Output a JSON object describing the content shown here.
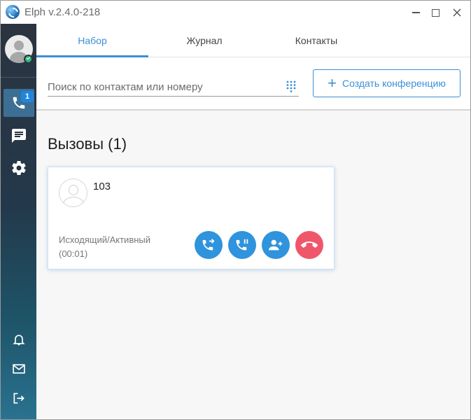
{
  "app": {
    "title": "Elph v.2.4.0-218"
  },
  "sidebar": {
    "calls_badge": "1",
    "items": [
      {
        "name": "calls",
        "icon": "phone-icon"
      },
      {
        "name": "chat",
        "icon": "chat-icon"
      },
      {
        "name": "settings",
        "icon": "gear-icon"
      },
      {
        "name": "notifications",
        "icon": "bell-icon"
      },
      {
        "name": "messages",
        "icon": "mail-icon"
      },
      {
        "name": "logout",
        "icon": "logout-icon"
      }
    ],
    "presence_status": "online"
  },
  "tabs": [
    {
      "label": "Набор",
      "active": true
    },
    {
      "label": "Журнал",
      "active": false
    },
    {
      "label": "Контакты",
      "active": false
    }
  ],
  "search": {
    "placeholder": "Поиск по контактам или номеру",
    "value": ""
  },
  "conference_button": {
    "label": "Создать конференцию"
  },
  "calls": {
    "title": "Вызовы (1)",
    "items": [
      {
        "number": "103",
        "status": "Исходящий/Активный",
        "duration": "(00:01)",
        "actions": [
          "transfer-icon",
          "hold-icon",
          "add-participant-icon",
          "hangup-icon"
        ]
      }
    ]
  },
  "colors": {
    "accent": "#3a8fd6",
    "action_button": "#2f93dd",
    "hangup": "#f0566a",
    "presence_online": "#2eb67d",
    "badge": "#1f86e0"
  }
}
